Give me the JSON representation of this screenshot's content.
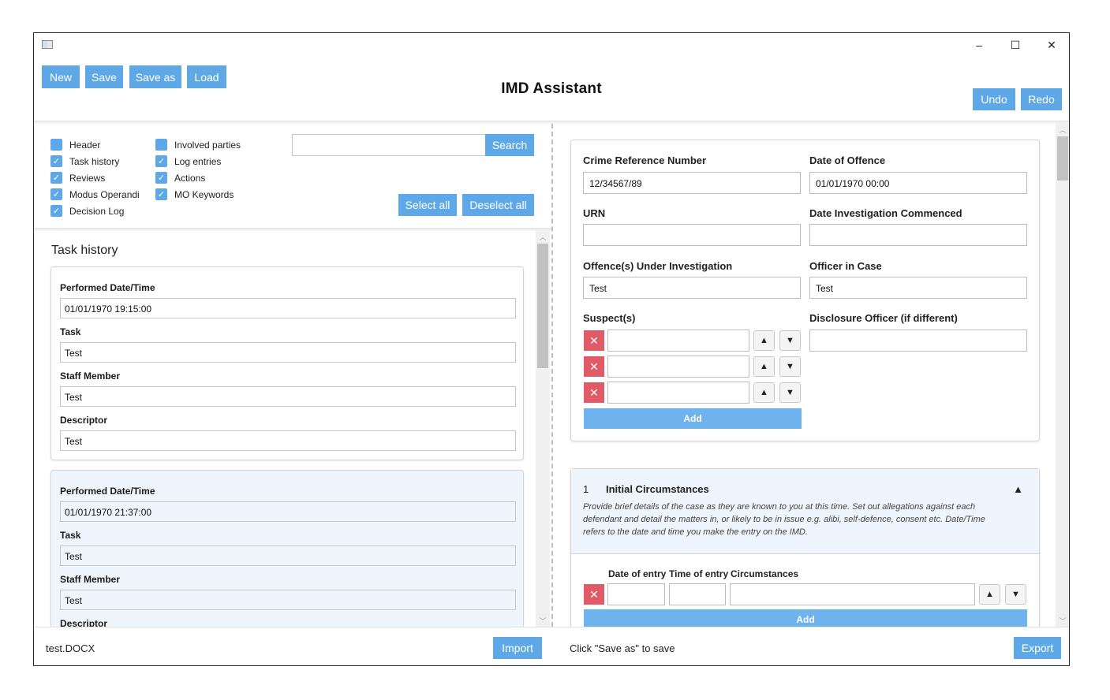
{
  "window": {
    "title": "IMD Assistant"
  },
  "controls": {
    "minimize": "–",
    "maximize": "☐",
    "close": "✕"
  },
  "toolbar": {
    "new": "New",
    "save": "Save",
    "save_as": "Save as",
    "load": "Load",
    "undo": "Undo",
    "redo": "Redo"
  },
  "filters": {
    "items": [
      {
        "label": "Header",
        "checked": false
      },
      {
        "label": "Task history",
        "checked": true
      },
      {
        "label": "Reviews",
        "checked": true
      },
      {
        "label": "Modus Operandi",
        "checked": true
      },
      {
        "label": "Decision Log",
        "checked": true
      },
      {
        "label": "Involved parties",
        "checked": false
      },
      {
        "label": "Log entries",
        "checked": true
      },
      {
        "label": "Actions",
        "checked": true
      },
      {
        "label": "MO Keywords",
        "checked": true
      }
    ],
    "search_value": "",
    "search_button": "Search",
    "select_all": "Select all",
    "deselect_all": "Deselect all"
  },
  "task_history": {
    "title": "Task history",
    "labels": {
      "performed": "Performed Date/Time",
      "task": "Task",
      "staff": "Staff Member",
      "descriptor": "Descriptor"
    },
    "entries": [
      {
        "performed": "01/01/1970 19:15:00",
        "task": "Test",
        "staff": "Test",
        "descriptor": "Test"
      },
      {
        "performed": "01/01/1970 21:37:00",
        "task": "Test",
        "staff": "Test",
        "descriptor": ""
      }
    ]
  },
  "header_form": {
    "crime_ref_label": "Crime Reference Number",
    "crime_ref_value": "12/34567/89",
    "date_offence_label": "Date of Offence",
    "date_offence_value": "01/01/1970 00:00",
    "urn_label": "URN",
    "urn_value": "",
    "date_commenced_label": "Date Investigation Commenced",
    "date_commenced_value": "",
    "offences_label": "Offence(s) Under Investigation",
    "offences_value": "Test",
    "officer_label": "Officer in Case",
    "officer_value": "Test",
    "suspects_label": "Suspect(s)",
    "suspects": [
      "",
      "",
      ""
    ],
    "disclosure_label": "Disclosure Officer (if different)",
    "disclosure_value": "",
    "add_label": "Add",
    "delete_glyph": "✕",
    "up_glyph": "▲",
    "down_glyph": "▼"
  },
  "initial_circumstances": {
    "number": "1",
    "title": "Initial Circumstances",
    "description": "Provide brief details of the case as they are known to you at this time. Set out allegations against each defendant and detail the matters in, or likely to be in issue e.g. alibi, self-defence, consent etc. Date/Time refers to the date and time you make the entry on the IMD.",
    "collapse_glyph": "▲",
    "col_date": "Date of entry",
    "col_time": "Time of entry",
    "col_circ": "Circumstances",
    "add_label": "Add"
  },
  "footer": {
    "filename": "test.DOCX",
    "import": "Import",
    "status": "Click \"Save as\" to save",
    "export": "Export"
  },
  "colors": {
    "accent": "#5fa8e8",
    "delete": "#e05a67",
    "alt_card": "#eef5fc"
  }
}
